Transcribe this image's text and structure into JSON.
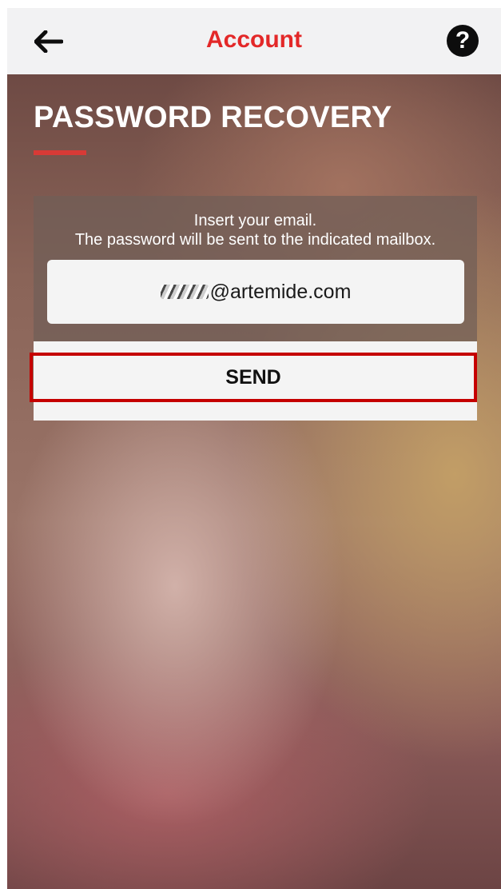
{
  "header": {
    "title": "Account",
    "back_icon": "arrow-left-icon",
    "help_icon": "question-circle-icon",
    "help_glyph": "?",
    "title_color": "#e32828"
  },
  "main": {
    "title": "PASSWORD RECOVERY",
    "underline_color": "#d83a36",
    "instruction_line1": "Insert your email.",
    "instruction_line2": "The password will be sent to the indicated mailbox.",
    "email_value": "@artemide.com",
    "send_label": "SEND",
    "send_highlight_color": "#c50000"
  }
}
